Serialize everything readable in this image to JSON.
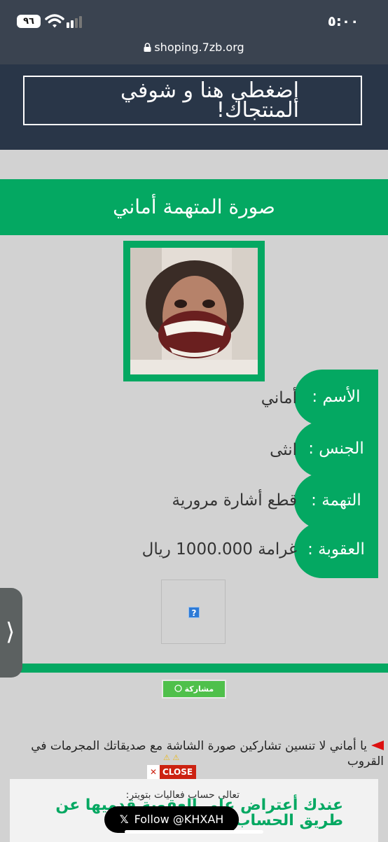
{
  "status_bar": {
    "time": "٥:٠٠",
    "battery": "٩٦"
  },
  "browser": {
    "url": "shoping.7zb.org"
  },
  "header": {
    "banner_text": "إضغطي هنا و شوفي المنتجاك!"
  },
  "profile": {
    "title": "صورة المتهمة أماني",
    "photo_alt": "photo",
    "rows": [
      {
        "label": "الأسم :",
        "value": "أماني"
      },
      {
        "label": "الجنس :",
        "value": "انثى"
      },
      {
        "label": "التهمة :",
        "value": "قطع أشارة مرورية"
      },
      {
        "label": "العقوبة :",
        "value": "غرامة 1000.000 ريال"
      }
    ]
  },
  "broken_image": {
    "glyph": "?"
  },
  "share": {
    "label": "مشاركة"
  },
  "side_tab": {
    "glyph": "⟩"
  },
  "message": {
    "text": "يا أماني لا تنسين تشاركين صورة الشاشة مع صديقاتك المجرمات في القروب"
  },
  "close_button": {
    "x": "✕",
    "label": "CLOSE"
  },
  "ad": {
    "subtitle": "تعالي حساب فعاليات بتويتر:",
    "title": "عندك أعتراض على العقوبة قدميها عن طريق الحساب !"
  },
  "follow_button": {
    "logo": "𝕏",
    "label": "Follow @KHXAH"
  },
  "colors": {
    "green": "#04a862",
    "header_dark": "#293648",
    "background": "#d2d2d2"
  }
}
